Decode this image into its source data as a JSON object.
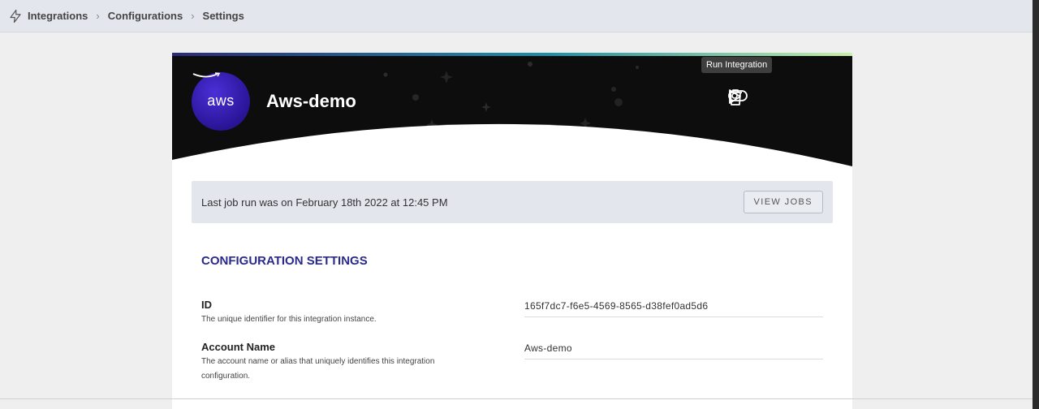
{
  "breadcrumb": {
    "items": [
      "Integrations",
      "Configurations",
      "Settings"
    ]
  },
  "integration": {
    "name": "Aws-demo",
    "logo_text": "aws"
  },
  "tooltip": "Run Integration",
  "last_job": {
    "message": "Last job run was on February 18th 2022 at 12:45 PM",
    "button": "VIEW JOBS"
  },
  "section_title": "CONFIGURATION SETTINGS",
  "fields": [
    {
      "label": "ID",
      "help": "The unique identifier for this integration instance.",
      "value": "165f7dc7-f6e5-4569-8565-d38fef0ad5d6"
    },
    {
      "label": "Account Name",
      "help": "The account name or alias that uniquely identifies this integration configuration.",
      "value": "Aws-demo"
    }
  ],
  "colors": {
    "accent": "#2b2a8a",
    "hero_bg": "#0d0d0d",
    "logo_bg": "#2a1496"
  }
}
